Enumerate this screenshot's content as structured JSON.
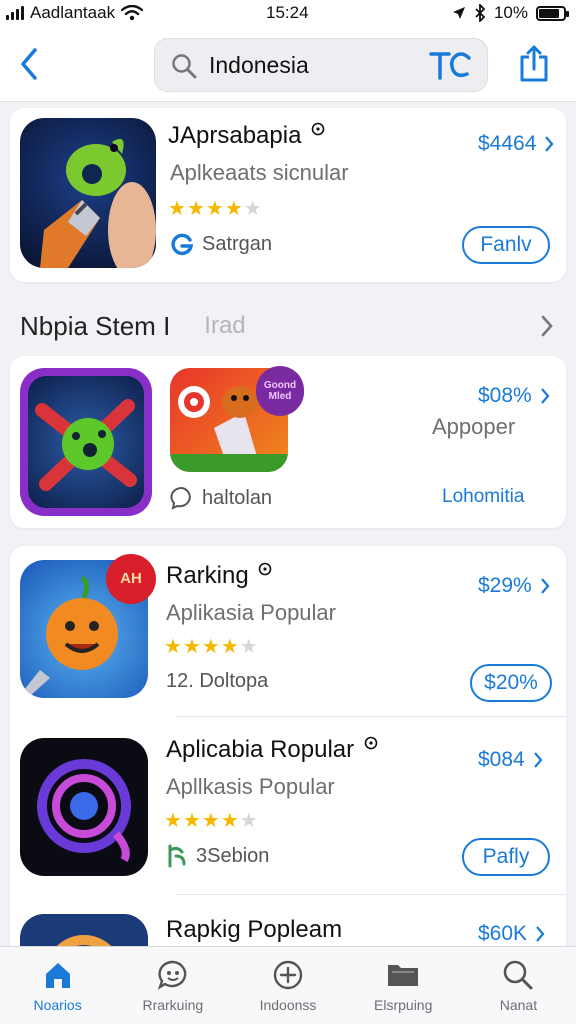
{
  "status": {
    "carrier": "Aadlantaak",
    "time": "15:24",
    "battery": "10%",
    "battery_level": 0.85
  },
  "search": {
    "value": "Indonesia"
  },
  "colors": {
    "accent": "#1a7ad8",
    "star": "#f5b800"
  },
  "featured": {
    "title": "JAprsabapia",
    "subtitle": "Aplkeaats sicnular",
    "price": "$4464",
    "rating": 4,
    "meta": "Satrgan",
    "action": "Fanlv",
    "icon": "green-bird-pen-icon"
  },
  "section": {
    "title": "Nbpia Stem I",
    "alt": "Irad"
  },
  "group": {
    "price": "$08%",
    "subtitle": "Appoper",
    "meta": "haltolan",
    "link": "Lohomitia",
    "badge_line1": "Goond",
    "badge_line2": "Mled"
  },
  "list": [
    {
      "title": "Rarking",
      "subtitle": "Aplikasia Popular",
      "price": "$29%",
      "rating": 4.5,
      "meta": "12. Doltopa",
      "action": "$20%",
      "badge": "AH",
      "icon": "orange-smiley-icon"
    },
    {
      "title": "Aplicabia Ropular",
      "subtitle": "Apllkasis Popular",
      "price": "$084",
      "rating": 4,
      "meta": "3Sebion",
      "action": "Pafly",
      "icon": "purple-swirl-icon"
    },
    {
      "title": "Rapkig Popleam",
      "price": "$60K",
      "icon": "orange-ring-icon"
    }
  ],
  "tabs": [
    {
      "label": "Noarios",
      "icon": "home-icon",
      "active": true
    },
    {
      "label": "Rrarkuing",
      "icon": "chat-face-icon",
      "active": false
    },
    {
      "label": "Indoonss",
      "icon": "plus-circle-icon",
      "active": false
    },
    {
      "label": "Elsrpuing",
      "icon": "folder-icon",
      "active": false
    },
    {
      "label": "Nanat",
      "icon": "search-icon",
      "active": false
    }
  ]
}
